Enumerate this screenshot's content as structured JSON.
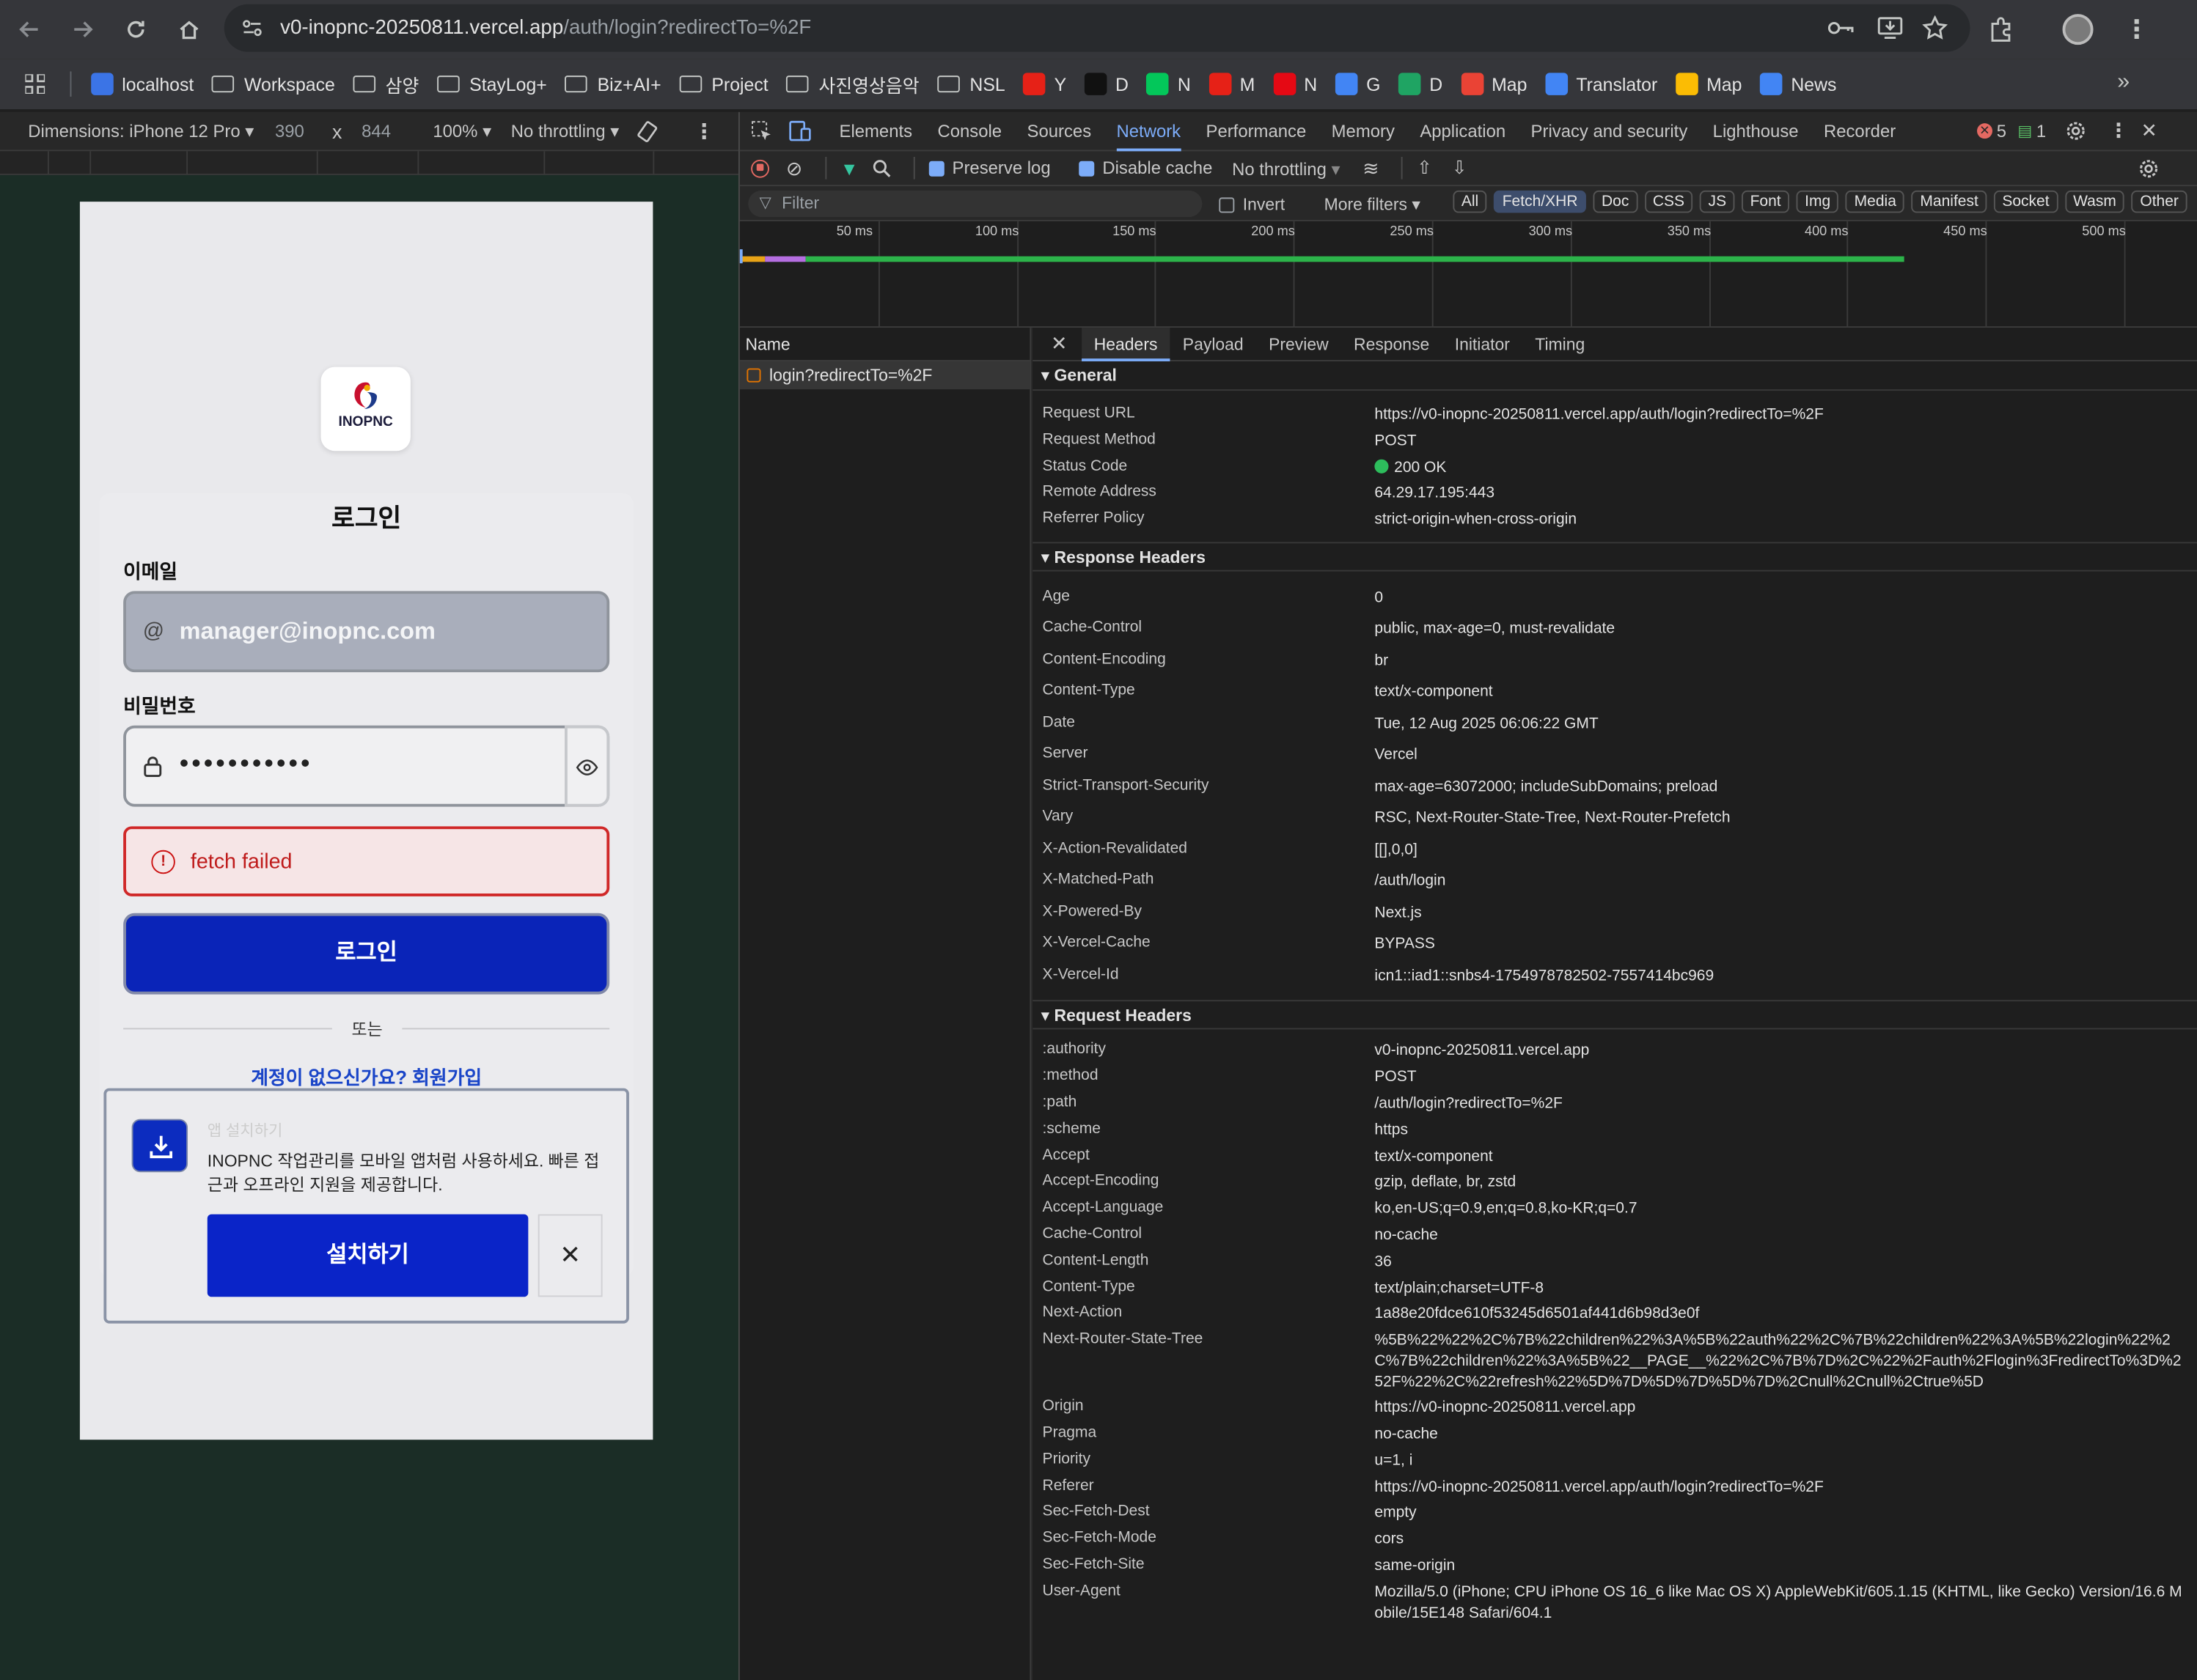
{
  "browser": {
    "url_host": "v0-inopnc-20250811.vercel.app",
    "url_path": "/auth/login?redirectTo=%2F"
  },
  "bookmarks": [
    {
      "label": "localhost",
      "icon": "globe-icon",
      "color": "#3b74e6"
    },
    {
      "label": "Workspace",
      "icon": "folder-icon"
    },
    {
      "label": "삼양",
      "icon": "folder-icon"
    },
    {
      "label": "StayLog+",
      "icon": "folder-icon"
    },
    {
      "label": "Biz+AI+",
      "icon": "folder-icon"
    },
    {
      "label": "Project",
      "icon": "folder-icon"
    },
    {
      "label": "사진영상음악",
      "icon": "folder-icon"
    },
    {
      "label": "NSL",
      "icon": "folder-icon"
    },
    {
      "label": "Y",
      "icon": "youtube-icon",
      "color": "#e62117"
    },
    {
      "label": "D",
      "icon": "d-icon",
      "color": "#111111"
    },
    {
      "label": "N",
      "icon": "naver-icon",
      "color": "#03c75a"
    },
    {
      "label": "M",
      "icon": "music-icon",
      "color": "#e62117"
    },
    {
      "label": "N",
      "icon": "netflix-icon",
      "color": "#e50914"
    },
    {
      "label": "G",
      "icon": "google-icon",
      "color": "#4285f4"
    },
    {
      "label": "D",
      "icon": "drive-icon",
      "color": "#1fa463"
    },
    {
      "label": "Map",
      "icon": "maps-icon",
      "color": "#ea4335"
    },
    {
      "label": "Translator",
      "icon": "translate-icon",
      "color": "#4285f4"
    },
    {
      "label": "Map",
      "icon": "maps-icon",
      "color": "#fbbc04"
    },
    {
      "label": "News",
      "icon": "news-icon",
      "color": "#4285f4"
    }
  ],
  "device_toolbar": {
    "dimensions_label": "Dimensions: iPhone 12 Pro",
    "width": "390",
    "times": "x",
    "height": "844",
    "zoom": "100%",
    "throttling": "No throttling"
  },
  "app": {
    "logo_text": "INOPNC",
    "title": "로그인",
    "email_label": "이메일",
    "email_value": "manager@inopnc.com",
    "password_label": "비밀번호",
    "password_value": "•••••••••••",
    "error_text": "fetch failed",
    "login_button": "로그인",
    "or_text": "또는",
    "signup_link": "계정이 없으신가요? 회원가입",
    "pwa_ghost": "앱 설치하기",
    "pwa_description": "INOPNC 작업관리를 모바일 앱처럼 사용하세요. 빠른 접근과 오프라인 지원을 제공합니다.",
    "install_button": "설치하기",
    "close_symbol": "✕"
  },
  "devtools": {
    "tabs": [
      "Elements",
      "Console",
      "Sources",
      "Network",
      "Performance",
      "Memory",
      "Application",
      "Privacy and security",
      "Lighthouse",
      "Recorder"
    ],
    "active_tab": "Network",
    "error_count": "5",
    "message_count": "1",
    "toolbar": {
      "preserve_log": "Preserve log",
      "disable_cache": "Disable cache",
      "throttling": "No throttling"
    },
    "filter": {
      "placeholder": "Filter",
      "invert": "Invert",
      "more_filters": "More filters",
      "types": [
        "All",
        "Fetch/XHR",
        "Doc",
        "CSS",
        "JS",
        "Font",
        "Img",
        "Media",
        "Manifest",
        "Socket",
        "Wasm",
        "Other"
      ],
      "active_type": "Fetch/XHR"
    },
    "timeline_ticks": [
      "50 ms",
      "100 ms",
      "150 ms",
      "200 ms",
      "250 ms",
      "300 ms",
      "350 ms",
      "400 ms",
      "450 ms",
      "500 ms"
    ],
    "name_header": "Name",
    "requests": [
      "login?redirectTo=%2F"
    ],
    "detail_tabs": [
      "Headers",
      "Payload",
      "Preview",
      "Response",
      "Initiator",
      "Timing"
    ],
    "active_detail_tab": "Headers",
    "general_title": "General",
    "general": [
      {
        "k": "Request URL",
        "v": "https://v0-inopnc-20250811.vercel.app/auth/login?redirectTo=%2F"
      },
      {
        "k": "Request Method",
        "v": "POST"
      },
      {
        "k": "Status Code",
        "v": "200 OK"
      },
      {
        "k": "Remote Address",
        "v": "64.29.17.195:443"
      },
      {
        "k": "Referrer Policy",
        "v": "strict-origin-when-cross-origin"
      }
    ],
    "response_title": "Response Headers",
    "response_headers": [
      {
        "k": "Age",
        "v": "0"
      },
      {
        "k": "Cache-Control",
        "v": "public, max-age=0, must-revalidate"
      },
      {
        "k": "Content-Encoding",
        "v": "br"
      },
      {
        "k": "Content-Type",
        "v": "text/x-component"
      },
      {
        "k": "Date",
        "v": "Tue, 12 Aug 2025 06:06:22 GMT"
      },
      {
        "k": "Server",
        "v": "Vercel"
      },
      {
        "k": "Strict-Transport-Security",
        "v": "max-age=63072000; includeSubDomains; preload"
      },
      {
        "k": "Vary",
        "v": "RSC, Next-Router-State-Tree, Next-Router-Prefetch"
      },
      {
        "k": "X-Action-Revalidated",
        "v": "[[],0,0]"
      },
      {
        "k": "X-Matched-Path",
        "v": "/auth/login"
      },
      {
        "k": "X-Powered-By",
        "v": "Next.js"
      },
      {
        "k": "X-Vercel-Cache",
        "v": "BYPASS"
      },
      {
        "k": "X-Vercel-Id",
        "v": "icn1::iad1::snbs4-1754978782502-7557414bc969"
      }
    ],
    "request_title": "Request Headers",
    "request_headers": [
      {
        "k": ":authority",
        "v": "v0-inopnc-20250811.vercel.app"
      },
      {
        "k": ":method",
        "v": "POST"
      },
      {
        "k": ":path",
        "v": "/auth/login?redirectTo=%2F"
      },
      {
        "k": ":scheme",
        "v": "https"
      },
      {
        "k": "Accept",
        "v": "text/x-component"
      },
      {
        "k": "Accept-Encoding",
        "v": "gzip, deflate, br, zstd"
      },
      {
        "k": "Accept-Language",
        "v": "ko,en-US;q=0.9,en;q=0.8,ko-KR;q=0.7"
      },
      {
        "k": "Cache-Control",
        "v": "no-cache"
      },
      {
        "k": "Content-Length",
        "v": "36"
      },
      {
        "k": "Content-Type",
        "v": "text/plain;charset=UTF-8"
      },
      {
        "k": "Next-Action",
        "v": "1a88e20fdce610f53245d6501af441d6b98d3e0f"
      },
      {
        "k": "Next-Router-State-Tree",
        "v": "%5B%22%22%2C%7B%22children%22%3A%5B%22auth%22%2C%7B%22children%22%3A%5B%22login%22%2C%7B%22children%22%3A%5B%22__PAGE__%22%2C%7B%7D%2C%22%2Fauth%2Flogin%3FredirectTo%3D%252F%22%2C%22refresh%22%5D%7D%5D%7D%5D%7D%2Cnull%2Cnull%2Ctrue%5D"
      },
      {
        "k": "Origin",
        "v": "https://v0-inopnc-20250811.vercel.app"
      },
      {
        "k": "Pragma",
        "v": "no-cache"
      },
      {
        "k": "Priority",
        "v": "u=1, i"
      },
      {
        "k": "Referer",
        "v": "https://v0-inopnc-20250811.vercel.app/auth/login?redirectTo=%2F"
      },
      {
        "k": "Sec-Fetch-Dest",
        "v": "empty"
      },
      {
        "k": "Sec-Fetch-Mode",
        "v": "cors"
      },
      {
        "k": "Sec-Fetch-Site",
        "v": "same-origin"
      },
      {
        "k": "User-Agent",
        "v": "Mozilla/5.0 (iPhone; CPU iPhone OS 16_6 like Mac OS X) AppleWebKit/605.1.15 (KHTML, like Gecko) Version/16.6 Mobile/15E148 Safari/604.1"
      }
    ]
  }
}
